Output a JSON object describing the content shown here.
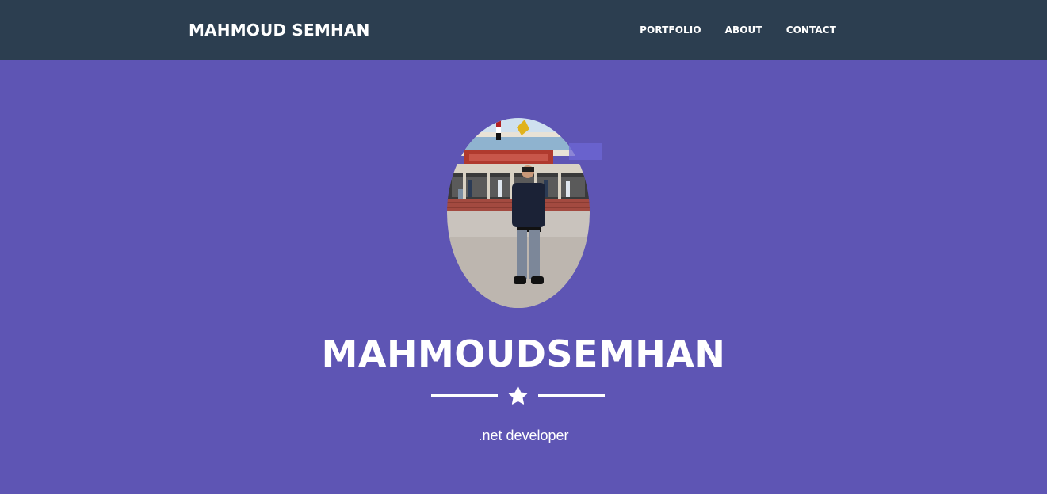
{
  "navbar": {
    "brand": "MAHMOUD SEMHAN",
    "links": [
      {
        "label": "PORTFOLIO"
      },
      {
        "label": "ABOUT"
      },
      {
        "label": "CONTACT"
      }
    ]
  },
  "masthead": {
    "avatar_icon": "profile-photo",
    "heading": "MAHMOUDSEMHAN",
    "divider_icon": "star-icon",
    "subheading": ".net developer"
  },
  "colors": {
    "navbar_bg": "#2c3e50",
    "masthead_bg": "#5e55b4",
    "text": "#ffffff"
  }
}
